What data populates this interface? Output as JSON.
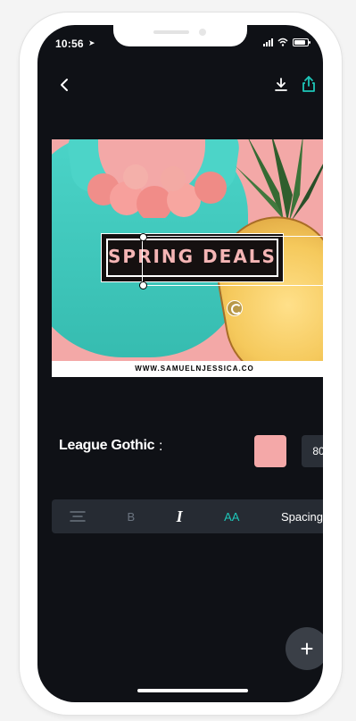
{
  "status": {
    "time": "10:56",
    "location_icon": "location-arrow-icon",
    "signal_icon": "signal-icon",
    "wifi_icon": "wifi-icon",
    "battery_icon": "battery-icon"
  },
  "nav": {
    "back_icon": "back-chevron-icon",
    "download_icon": "download-icon",
    "share_icon": "share-icon"
  },
  "design": {
    "headline": "SPRING DEALS",
    "footer_url": "WWW.SAMUELNJESSICA.CO",
    "rotate_icon": "rotate-icon"
  },
  "text_controls": {
    "font_name": "League Gothic",
    "font_menu": ":",
    "color": "#f4a8a8",
    "size": "80"
  },
  "toolbar": {
    "align_icon": "align-center-icon",
    "bold_label": "B",
    "italic_label": "I",
    "case_label": "AA",
    "spacing_label": "Spacing"
  },
  "fab": {
    "label": "+"
  },
  "colors": {
    "background": "#0f1116",
    "panel": "#262b33",
    "accent": "#1ec6b8",
    "swatch": "#f4a8a8"
  }
}
